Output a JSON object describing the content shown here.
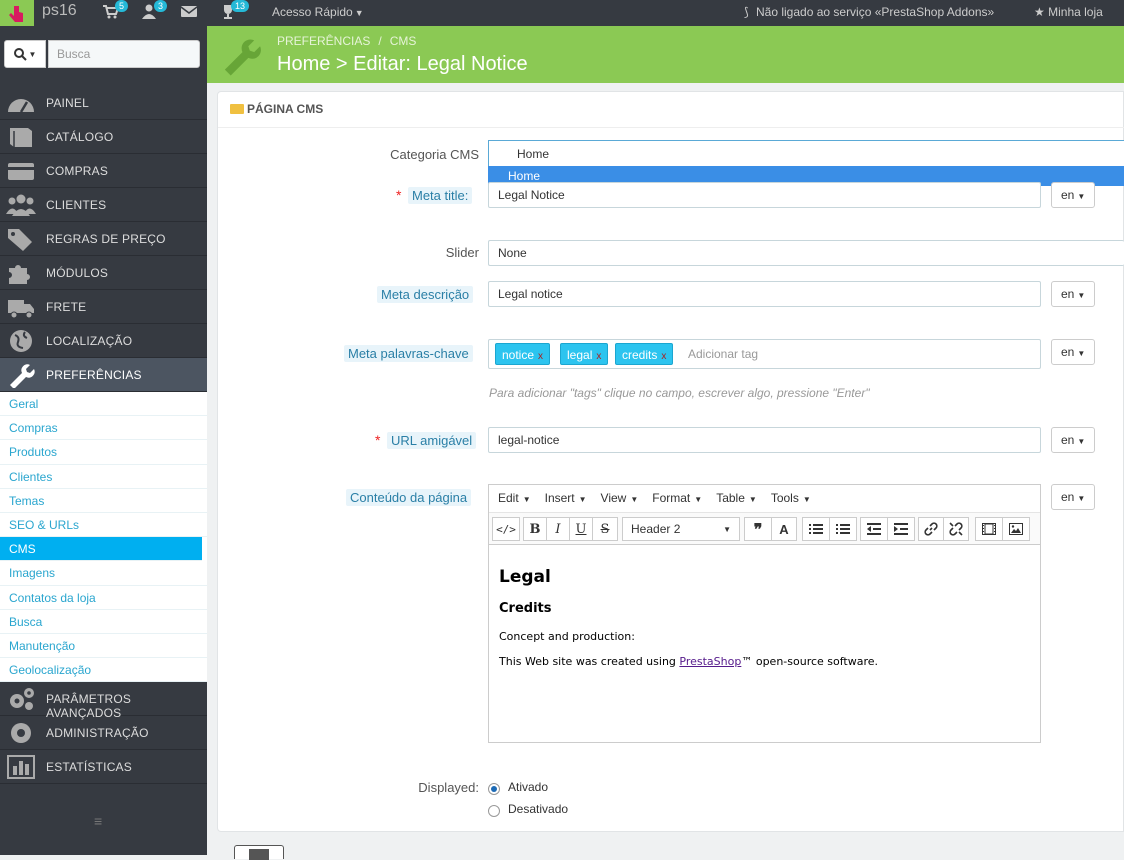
{
  "topbar": {
    "shop_name": "ps16",
    "cart_badge": "5",
    "users_badge": "3",
    "trophy_badge": "13",
    "quick_access": "Acesso Rápido",
    "addons_status": "Não ligado ao serviço «PrestaShop Addons»",
    "my_store": "Minha loja"
  },
  "sidebar": {
    "search_placeholder": "Busca",
    "items": [
      {
        "label": "PAINEL",
        "icon": "dashboard-icon"
      },
      {
        "label": "CATÁLOGO",
        "icon": "book-icon"
      },
      {
        "label": "COMPRAS",
        "icon": "credit-card-icon"
      },
      {
        "label": "CLIENTES",
        "icon": "users-icon"
      },
      {
        "label": "REGRAS DE PREÇO",
        "icon": "tags-icon"
      },
      {
        "label": "MÓDULOS",
        "icon": "puzzle-icon"
      },
      {
        "label": "FRETE",
        "icon": "truck-icon"
      },
      {
        "label": "LOCALIZAÇÃO",
        "icon": "globe-icon"
      },
      {
        "label": "PREFERÊNCIAS",
        "icon": "wrench-icon"
      }
    ],
    "sub_items": [
      "Geral",
      "Compras",
      "Produtos",
      "Clientes",
      "Temas",
      "SEO & URLs",
      "CMS",
      "Imagens",
      "Contatos da loja",
      "Busca",
      "Manutenção",
      "Geolocalização"
    ],
    "items2": [
      {
        "label": "PARÂMETROS AVANÇADOS",
        "icon": "gears-icon"
      },
      {
        "label": "ADMINISTRAÇÃO",
        "icon": "cog-icon"
      },
      {
        "label": "ESTATÍSTICAS",
        "icon": "bar-chart-icon"
      }
    ]
  },
  "header": {
    "crumb1": "PREFERÊNCIAS",
    "crumb_sep": "/",
    "crumb2": "CMS",
    "title": "Home > Editar: Legal Notice"
  },
  "panel": {
    "heading": "PÁGINA CMS"
  },
  "form": {
    "categoria_label": "Categoria CMS",
    "categoria_value": "Home",
    "categoria_option": "Home",
    "meta_title_label": "Meta title:",
    "meta_title_value": "Legal Notice",
    "slider_label": "Slider",
    "slider_value": "None",
    "meta_desc_label": "Meta descrição",
    "meta_desc_value": "Legal notice",
    "keywords_label": "Meta palavras-chave",
    "tags": [
      "notice",
      "legal",
      "credits"
    ],
    "tag_remove": "x",
    "tag_placeholder": "Adicionar tag",
    "tag_hint": "Para adicionar \"tags\" clique no campo, escrever algo, pressione \"Enter\"",
    "url_label": "URL amigável",
    "url_value": "legal-notice",
    "content_label": "Conteúdo da página",
    "lang": "en",
    "required_mark": "*",
    "displayed_label": "Displayed:",
    "radio_on": "Ativado",
    "radio_off": "Desativado"
  },
  "editor": {
    "menus": [
      "Edit",
      "Insert",
      "View",
      "Format",
      "Table",
      "Tools"
    ],
    "block_format": "Header 2",
    "heading1": "Legal",
    "heading2": "Credits",
    "para1": "Concept and production:",
    "para2_pre": "This Web site was created using ",
    "para2_link": "PrestaShop",
    "para2_post": "™ open-source software."
  }
}
